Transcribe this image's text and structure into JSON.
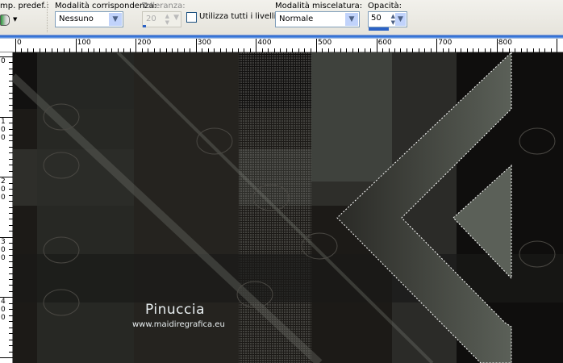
{
  "toolbar": {
    "preset_label": "mp. predef.:",
    "match_mode_label": "Modalità corrispondenza:",
    "match_mode_value": "Nessuno",
    "tolerance_label": "Tolleranza:",
    "tolerance_value": "20",
    "use_all_layers_label": "Utilizza tutti i livelli",
    "use_all_layers_checked": false,
    "blend_mode_label": "Modalità miscelatura:",
    "blend_mode_value": "Normale",
    "opacity_label": "Opacità:",
    "opacity_value": "50"
  },
  "ruler": {
    "h_labels": [
      "0",
      "100",
      "200",
      "300",
      "400",
      "500",
      "600",
      "700",
      "800"
    ],
    "v_labels": [
      "0",
      "100",
      "200",
      "300",
      "400"
    ]
  },
  "canvas": {
    "watermark_name": "Pinuccia",
    "watermark_url": "www.maidiregrafica.eu"
  }
}
